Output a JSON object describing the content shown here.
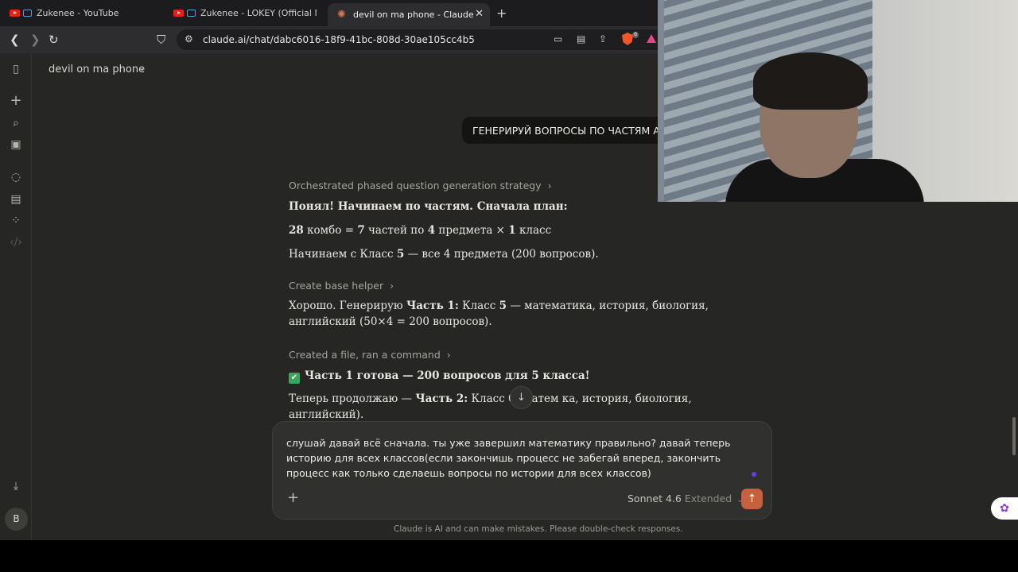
{
  "browser": {
    "tabs": [
      {
        "title": "Zukenee - YouTube",
        "active": false
      },
      {
        "title": "Zukenee - LOKEY (Official Music V",
        "active": false
      },
      {
        "title": "devil on ma phone - Claude",
        "active": true
      }
    ],
    "url": "claude.ai/chat/dabc6016-18f9-41bc-808d-30ae105cc4b5",
    "brave_badge": "0"
  },
  "sidebar": {
    "avatar_initial": "B"
  },
  "chat": {
    "title": "devil on ma phone",
    "user_message": "ГЕНЕРИРУЙ ВОПРОСЫ ПО ЧАСТЯМ А Н",
    "steps": [
      "Orchestrated phased question generation strategy",
      "Create base helper",
      "Created a file, ran a command"
    ],
    "messages": {
      "m1": "Понял! Начинаем по частям. Сначала план:",
      "m2_num1": "28",
      "m2_a": " комбо = ",
      "m2_num2": "7",
      "m2_b": " частей по ",
      "m2_num3": "4",
      "m2_c": " предмета × ",
      "m2_num4": "1",
      "m2_d": " класс",
      "m3_a": "Начинаем с Класс ",
      "m3_num": "5",
      "m3_b": " — все 4 предмета (200 вопросов).",
      "m4_a": "Хорошо. Генерирую ",
      "m4_bold": "Часть 1:",
      "m4_b": " Класс ",
      "m4_num": "5",
      "m4_c": " — математика, история, биология, английский (50×4 = 200 вопросов).",
      "m5_bold": "Часть 1 готова — 200",
      "m5_rest": " вопросов для ",
      "m5_num": "5",
      "m5_end": " класса!",
      "m6_a": "Теперь продолжаю — ",
      "m6_bold": "Часть 2:",
      "m6_b": " Класс ",
      "m6_num": "6",
      "m6_c": " (матем   ка, история, биология, английский)."
    }
  },
  "composer": {
    "text": "слушай давай всё сначала. ты уже завершил математику правильно? давай теперь историю для всех классов(если закончишь процесс не забегай вперед, закончить процесс как только сделаешь вопросы по истории для всех классов)",
    "model": "Sonnet 4.6",
    "mode": "Extended"
  },
  "disclaimer": "Claude is AI and can make mistakes. Please double-check responses."
}
